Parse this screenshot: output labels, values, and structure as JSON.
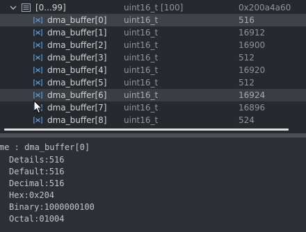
{
  "tree": {
    "parent": {
      "name": "[0...99]",
      "type": "uint16_t [100]",
      "value": "0x200a4a60",
      "icon": "array-icon"
    },
    "rows": [
      {
        "name": "dma_buffer[0]",
        "type": "uint16_t",
        "value": "516",
        "state": "selected"
      },
      {
        "name": "dma_buffer[1]",
        "type": "uint16_t",
        "value": "16912"
      },
      {
        "name": "dma_buffer[2]",
        "type": "uint16_t",
        "value": "16900"
      },
      {
        "name": "dma_buffer[3]",
        "type": "uint16_t",
        "value": "512"
      },
      {
        "name": "dma_buffer[4]",
        "type": "uint16_t",
        "value": "16920"
      },
      {
        "name": "dma_buffer[5]",
        "type": "uint16_t",
        "value": "512"
      },
      {
        "name": "dma_buffer[6]",
        "type": "uint16_t",
        "value": "16924",
        "state": "hover"
      },
      {
        "name": "dma_buffer[7]",
        "type": "uint16_t",
        "value": "16896"
      },
      {
        "name": "dma_buffer[8]",
        "type": "uint16_t",
        "value": "524"
      }
    ]
  },
  "details": {
    "title": "me : dma_buffer[0]",
    "lines": [
      "Details:516",
      "Default:516",
      "Decimal:516",
      "Hex:0x204",
      "Binary:1000000100",
      "Octal:01004"
    ]
  },
  "colors": {
    "background": "#26292d",
    "selected_row": "#3f4347",
    "details_bg": "#2c3034",
    "variable_icon": "#5b9bd5"
  }
}
